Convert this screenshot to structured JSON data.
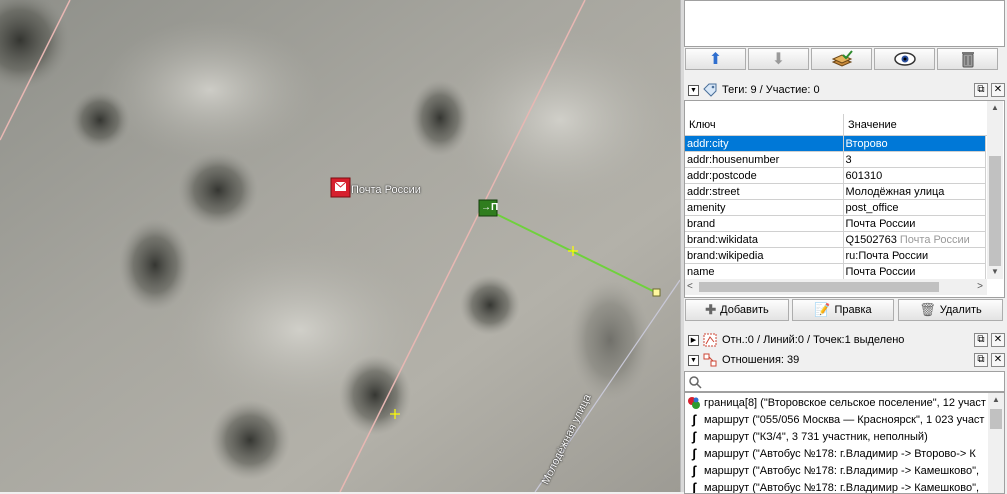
{
  "map": {
    "poi_label": "Почта России",
    "street_label": "Молодёжная улица",
    "node_badge": "→П"
  },
  "toolbar": {
    "buttons": [
      {
        "icon": "arrow-up-icon"
      },
      {
        "icon": "arrow-down-icon"
      },
      {
        "icon": "layers-check-icon"
      },
      {
        "icon": "eye-icon"
      },
      {
        "icon": "trash-icon"
      }
    ]
  },
  "tags_panel": {
    "title": "Теги: 9 / Участие: 0",
    "col_key": "Ключ",
    "col_value": "Значение",
    "rows": [
      {
        "key": "addr:city",
        "value": "Второво",
        "selected": true
      },
      {
        "key": "addr:housenumber",
        "value": "3"
      },
      {
        "key": "addr:postcode",
        "value": "601310"
      },
      {
        "key": "addr:street",
        "value": "Молодёжная улица"
      },
      {
        "key": "amenity",
        "value": "post_office"
      },
      {
        "key": "brand",
        "value": "Почта России"
      },
      {
        "key": "brand:wikidata",
        "value": "Q1502763",
        "hint": "Почта России"
      },
      {
        "key": "brand:wikipedia",
        "value": "ru:Почта России"
      },
      {
        "key": "name",
        "value": "Почта России"
      }
    ],
    "add_label": "Добавить",
    "edit_label": "Правка",
    "delete_label": "Удалить"
  },
  "selection_panel": {
    "title": "Отн.:0 / Линий:0 / Точек:1 выделено"
  },
  "relations_panel": {
    "title": "Отношения: 39",
    "search_placeholder": "",
    "rows": [
      {
        "icon": "boundary-icon",
        "text": "граница[8] (\"Второвское сельское поселение\", 12 участ"
      },
      {
        "icon": "route-icon",
        "text": "маршрут (\"055/056 Москва — Красноярск\", 1 023 участ"
      },
      {
        "icon": "route-icon",
        "text": "маршрут (\"КЗ/4\", 3 731 участник, неполный)"
      },
      {
        "icon": "route-icon",
        "text": "маршрут (\"Автобус №178: г.Владимир -> Второво-> К"
      },
      {
        "icon": "route-icon",
        "text": "маршрут (\"Автобус №178: г.Владимир -> Камешково\","
      },
      {
        "icon": "route-icon",
        "text": "маршрут (\"Автобус №178: г.Владимир -> Камешково\","
      }
    ]
  },
  "colors": {
    "selection": "#0078d7",
    "way_selected": "#6fd13c",
    "road_line": "#e8b7b3",
    "poi_red": "#d6202e",
    "node_green": "#2f7d1e"
  }
}
